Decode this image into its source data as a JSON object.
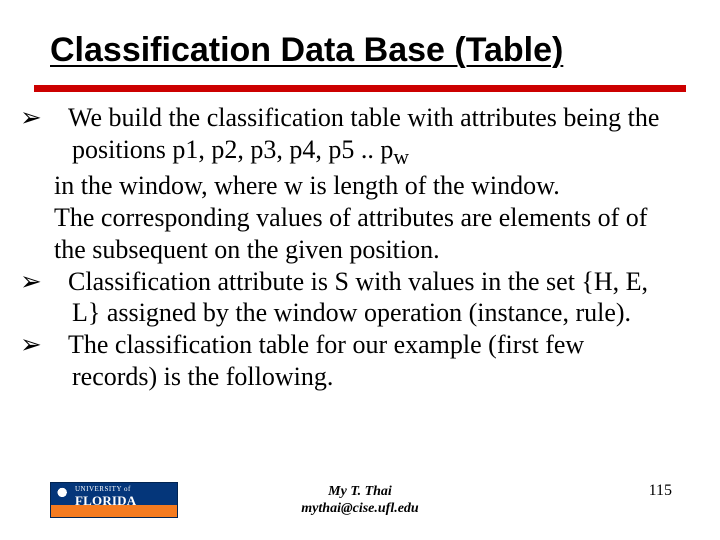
{
  "title": "Classification Data Base (Table)",
  "bullets": [
    {
      "lead": "We build the classification table with attributes being the positions p1, p2, p3, p4, p5 .. p",
      "sub": "w",
      "lines": [
        "in the window, where w is length of the window.",
        "The corresponding values of attributes are elements of of the subsequent on the given position."
      ]
    },
    {
      "lead": "Classification  attribute is S with values in the set {H, E, L} assigned by the window operation (instance, rule)."
    },
    {
      "lead": "The classification table for our example (first few records) is the following."
    }
  ],
  "logo": {
    "top": "UNIVERSITY of",
    "main": "FLORIDA"
  },
  "author": {
    "name": "My T. Thai",
    "email": "mythai@cise.ufl.edu"
  },
  "page": "115",
  "glyph": {
    "arrow": "➢"
  }
}
